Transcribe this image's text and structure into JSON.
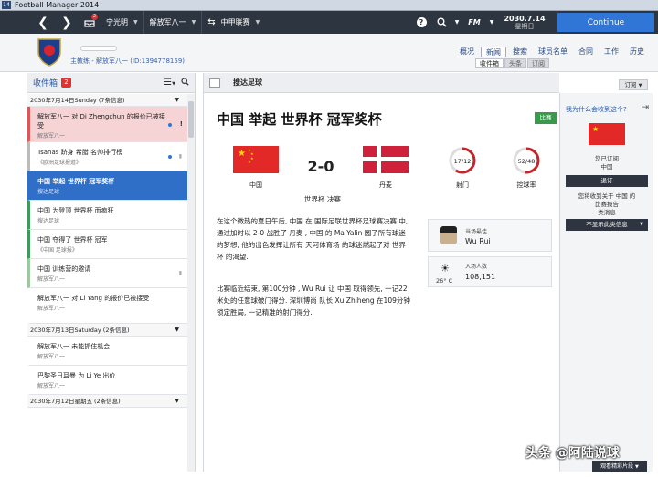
{
  "window": {
    "title": "Football Manager 2014",
    "app_icon": "14"
  },
  "toolbar": {
    "inbox_badge": "2",
    "manager_name": "宁光明",
    "club_menu": "解放军八一",
    "competition_menu": "中甲联赛",
    "date": "2030.7.14",
    "day": "星期日",
    "fm_label": "FM",
    "continue_label": "Continue"
  },
  "header": {
    "club_line": "主教练 - 解放军八一 (ID:1394778159)",
    "nav": [
      "概况",
      "新闻",
      "搜索",
      "球员名单",
      "合同",
      "工作",
      "历史"
    ],
    "active_nav": "新闻",
    "subtabs": [
      "收件箱",
      "头条",
      "订阅"
    ]
  },
  "inbox": {
    "title": "收件箱",
    "badge": "2",
    "groups": [
      {
        "date": "2030年7月14日Sunday (7条信息)",
        "items": [
          {
            "title": "解放军八一 对 Di Zhengchun 的报价已被接受",
            "sub": "解放军八一",
            "style": "red",
            "dot": true,
            "flag": "!"
          },
          {
            "title": "Tsanas 跻身 希腊 名帅排行榜",
            "sub": "《欧洲足球报道》",
            "style": "gray",
            "dot": true,
            "clip": true
          },
          {
            "title": "中国 举起 世界杯 冠军奖杯",
            "sub": "搜达足球",
            "style": "sel"
          },
          {
            "title": "中国 为登顶 世界杯 而疯狂",
            "sub": "搜达足球",
            "style": "green"
          },
          {
            "title": "中国 夺得了 世界杯 冠军",
            "sub": "《中国 足球报》",
            "style": "green"
          },
          {
            "title": "中国 训练营的邀请",
            "sub": "解放军八一",
            "style": "ltgreen",
            "clip": true
          },
          {
            "title": "解放军八一 对 Li Yang 的报价已被接受",
            "sub": "解放军八一",
            "style": "none"
          }
        ]
      },
      {
        "date": "2030年7月13日Saturday (2条信息)",
        "items": [
          {
            "title": "解放军八一 未能抓住机会",
            "sub": "解放军八一",
            "style": "none"
          },
          {
            "title": "巴黎圣日耳曼 为 Li Ye 出价",
            "sub": "解放军八一",
            "style": "none"
          }
        ]
      },
      {
        "date": "2030年7月12日星期五 (2条信息)",
        "items": []
      }
    ]
  },
  "article": {
    "source": "搜达足球",
    "headline": "中国 举起 世界杯 冠军奖杯",
    "competition_tag": "比赛",
    "home_team": "中国",
    "away_team": "丹麦",
    "score": "2-0",
    "final_label": "世界杯 决赛",
    "stats": [
      {
        "label": "射门",
        "value": "17/12",
        "fraction": 0.59
      },
      {
        "label": "控球率",
        "value": "52/48",
        "fraction": 0.52
      }
    ],
    "paragraph1": "在这个微热的夏日午后, 中国 在 国际足联世界杯足球赛决赛 中, 通过加时以 2-0 战胜了 丹麦 , 中国 的 Ma Yalin 圆了所有球迷的梦想, 他的出色发挥让所有 天河体育场 的球迷燃起了对 世界杯 的渴望.",
    "paragraph2": "比赛临近结束, 第100分钟 , Wu Rui 让 中国 取得领先, 一记22米处的任意球破门得分. 深圳博尚 队长 Xu Zhiheng 在109分钟锁定胜局, 一记精准的射门得分.",
    "motm_label": "当场最佳",
    "motm_name": "Wu Rui",
    "attendance_label": "入场人数",
    "attendance": "108,151",
    "temperature": "26° C",
    "header_button": "订阅"
  },
  "side": {
    "title": "我为什么会收到这个?",
    "subscribed": "您已订阅",
    "country": "中国",
    "subscribe_btn": "退订",
    "reason_lines": [
      "您将收到关于 中国 的",
      "比赛报告",
      "类消息"
    ],
    "hide_btn": "不显示此类信息"
  },
  "bottom": {
    "watermark": "头条 @阿陆说球",
    "highlights_btn": "观看精彩片段"
  },
  "colors": {
    "accent": "#2f76d6",
    "toolbar": "#2d3540",
    "inbox_red": "#f6d3d5",
    "green_tag": "#3a9a4c"
  }
}
